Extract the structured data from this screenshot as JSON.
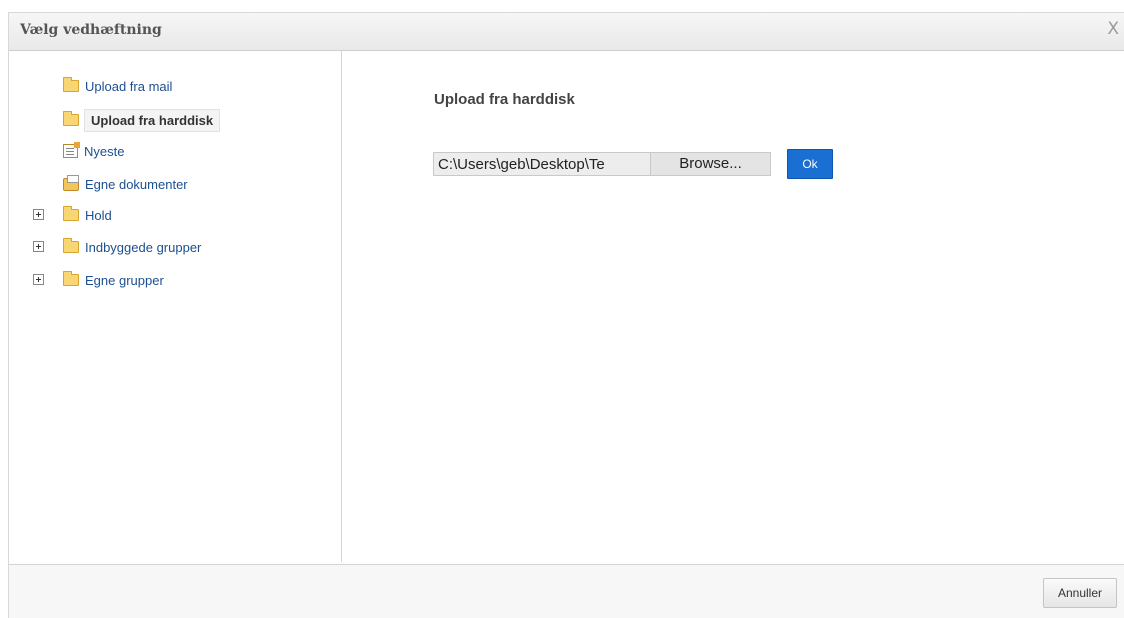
{
  "dialog": {
    "title": "Vælg vedhæftning",
    "close_label": "X"
  },
  "tree": {
    "items": [
      {
        "label": "Upload fra mail",
        "icon": "folder-icon",
        "expandable": false,
        "selected": false
      },
      {
        "label": "Upload fra harddisk",
        "icon": "folder-icon",
        "expandable": false,
        "selected": true
      },
      {
        "label": "Nyeste",
        "icon": "document-icon",
        "expandable": false,
        "selected": false
      },
      {
        "label": "Egne dokumenter",
        "icon": "documents-icon",
        "expandable": false,
        "selected": false
      },
      {
        "label": "Hold",
        "icon": "folder-icon",
        "expandable": true,
        "selected": false
      },
      {
        "label": "Indbyggede grupper",
        "icon": "folder-icon",
        "expandable": true,
        "selected": false
      },
      {
        "label": "Egne grupper",
        "icon": "folder-icon",
        "expandable": true,
        "selected": false
      }
    ]
  },
  "panel": {
    "heading": "Upload fra harddisk",
    "file_path": "C:\\Users\\geb\\Desktop\\Te",
    "browse_label": "Browse...",
    "ok_label": "Ok"
  },
  "footer": {
    "cancel_label": "Annuller"
  },
  "colors": {
    "link": "#1d4f91",
    "accent": "#1a6fd3"
  }
}
